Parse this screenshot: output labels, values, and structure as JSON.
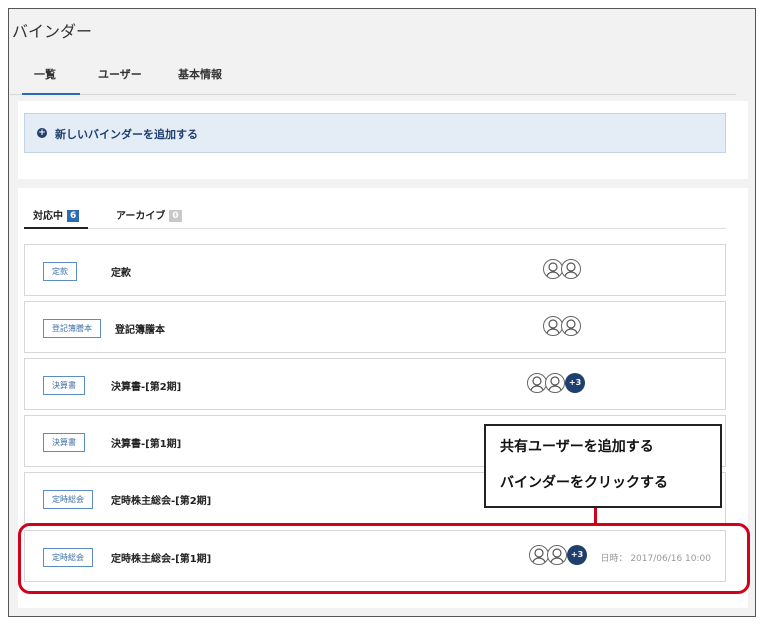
{
  "window_title": "バインダー",
  "top_tabs": [
    {
      "label": "一覧",
      "active": true
    },
    {
      "label": "ユーザー"
    },
    {
      "label": "基本情報"
    }
  ],
  "add_binder_label": "新しいバインダーを追加する",
  "sub_tabs": [
    {
      "label": "対応中",
      "count": "6"
    },
    {
      "label": "アーカイブ",
      "count": "0"
    }
  ],
  "binders": [
    {
      "tag": "定款",
      "title": "定款",
      "more": ""
    },
    {
      "tag": "登記簿謄本",
      "title": "登記簿謄本",
      "more": ""
    },
    {
      "tag": "決算書",
      "title": "決算書-[第2期]",
      "more": "+3"
    },
    {
      "tag": "決算書",
      "title": "決算書-[第1期]",
      "more": ""
    },
    {
      "tag": "定時総会",
      "title": "定時株主総会-[第2期]",
      "more": ""
    },
    {
      "tag": "定時総会",
      "title": "定時株主総会-[第1期]",
      "more": "+3",
      "datetime": "日時： 2017/06/16 10:00"
    }
  ],
  "callout": {
    "line1": "共有ユーザーを追加する",
    "line2": "バインダーをクリックする"
  },
  "colors": {
    "accent": "#2a6ab6",
    "navy": "#1f3f6e",
    "highlight": "#d0021b"
  }
}
